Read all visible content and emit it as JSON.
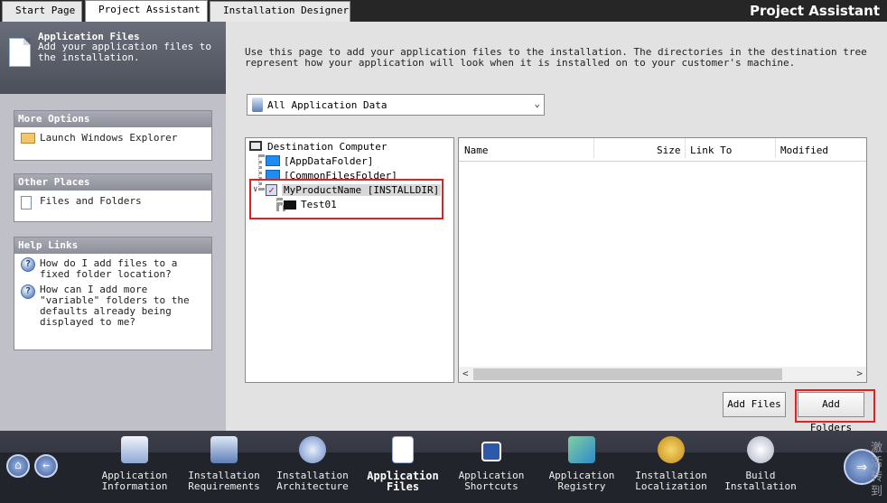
{
  "tabs": {
    "start_page": "Start Page",
    "project_assistant": "Project Assistant",
    "installation_designer": "Installation Designer"
  },
  "app_title": "Project Assistant",
  "left": {
    "header_title": "Application Files",
    "header_desc": "Add your application files to the installation.",
    "more_options": {
      "title": "More Options",
      "items": [
        "Launch Windows Explorer"
      ]
    },
    "other_places": {
      "title": "Other Places",
      "items": [
        "Files and Folders"
      ]
    },
    "help_links": {
      "title": "Help Links",
      "items": [
        "How do I add files to a fixed folder location?",
        "How can I add more \"variable\" folders to the defaults already being displayed to me?"
      ]
    }
  },
  "main": {
    "intro": "Use this page to add your application files to the installation. The directories in the destination tree represent how your application will look when it is installed on to your customer's machine.",
    "filter_selected": "All Application Data",
    "tree": {
      "root": "Destination Computer",
      "nodes": [
        "[AppDataFolder]",
        "[CommonFilesFolder]",
        "MyProductName [INSTALLDIR]",
        "Test01"
      ]
    },
    "list_columns": [
      "Name",
      "Size",
      "Link To",
      "Modified"
    ],
    "buttons": {
      "add_files": "Add Files",
      "add_folders": "Add Folders"
    }
  },
  "bottom_nav": [
    {
      "line1": "Application",
      "line2": "Information"
    },
    {
      "line1": "Installation",
      "line2": "Requirements"
    },
    {
      "line1": "Installation",
      "line2": "Architecture"
    },
    {
      "line1": "Application",
      "line2": "Files"
    },
    {
      "line1": "Application",
      "line2": "Shortcuts"
    },
    {
      "line1": "Application",
      "line2": "Registry"
    },
    {
      "line1": "Installation",
      "line2": "Localization"
    },
    {
      "line1": "Build",
      "line2": "Installation"
    }
  ],
  "watermark": "激活\n转到"
}
